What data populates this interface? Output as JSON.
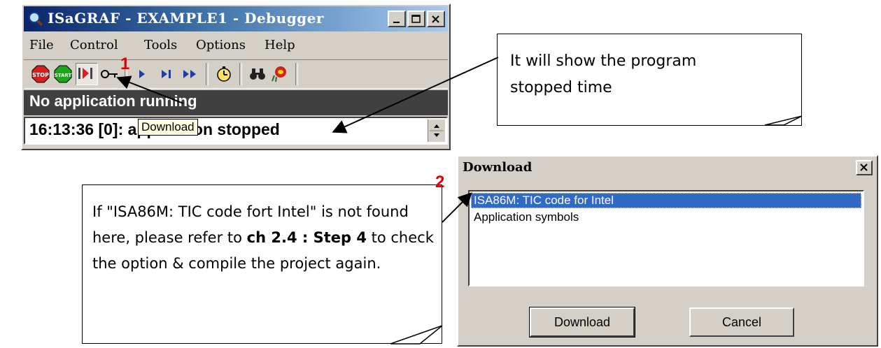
{
  "debugger": {
    "title": "ISaGRAF - EXAMPLE1 - Debugger",
    "menu": [
      "File",
      "Control",
      "Tools",
      "Options",
      "Help"
    ],
    "toolbar_icons": [
      "stop-icon",
      "start-icon",
      "download-icon",
      "key-icon",
      "run-icon",
      "step-icon",
      "fast-forward-icon",
      "timer-icon",
      "binoculars-icon",
      "spy-icon"
    ],
    "status": "No application running",
    "message": "16:13:36 [0]: application stopped",
    "tooltip": "Download"
  },
  "labels": {
    "step1": "1",
    "step2": "2"
  },
  "callout_top": {
    "line1": "It will show the program",
    "line2": "stopped time"
  },
  "callout_bottom": {
    "part1": "If \"ISA86M: TIC code fort Intel\" is not found here, please refer to ",
    "bold": "ch 2.4 : Step 4",
    "part2": " to check the option & compile the project again."
  },
  "download_dialog": {
    "title": "Download",
    "items": [
      "ISA86M: TIC code for Intel",
      "Application symbols"
    ],
    "selected_index": 0,
    "buttons": {
      "download": "Download",
      "cancel": "Cancel"
    }
  },
  "colors": {
    "title_bar": "#0a246a",
    "selection": "#316ac5",
    "step_label": "#e00000",
    "status_bar": "#404040"
  }
}
